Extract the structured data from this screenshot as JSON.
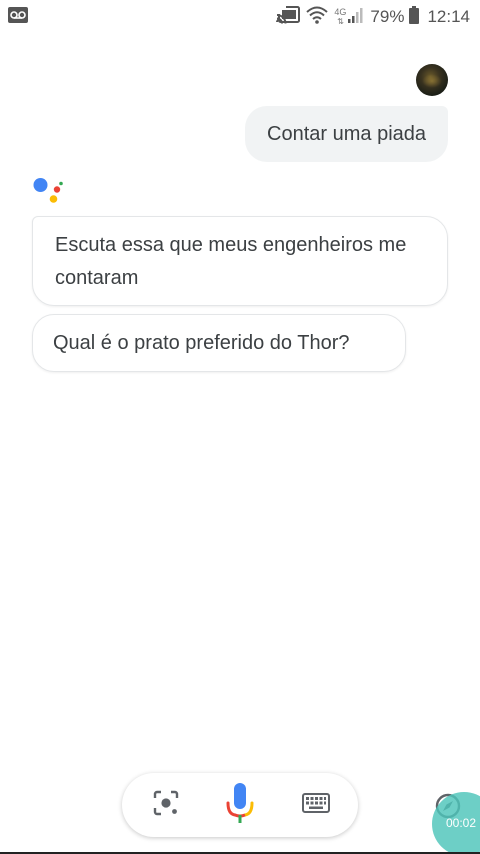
{
  "status_bar": {
    "network_type": "4G",
    "battery_percent": "79%",
    "time": "12:14",
    "icons": [
      "voicemail-icon",
      "cast-icon",
      "wifi-icon",
      "signal-icon",
      "battery-icon"
    ]
  },
  "conversation": {
    "user_query": "Contar uma piada",
    "assistant_replies": [
      "Escuta essa que meus engenheiros me contaram",
      "Qual é o prato preferido do Thor?"
    ]
  },
  "bottom_bar": {
    "icons": [
      "lens-icon",
      "microphone-icon",
      "keyboard-icon"
    ]
  },
  "screen_recorder": {
    "elapsed": "00:02"
  },
  "colors": {
    "google_blue": "#4285F4",
    "google_red": "#EA4335",
    "google_yellow": "#FBBC05",
    "google_green": "#34A853",
    "bubble_gray": "#F1F3F4",
    "recorder_teal": "#4DC4BA"
  }
}
